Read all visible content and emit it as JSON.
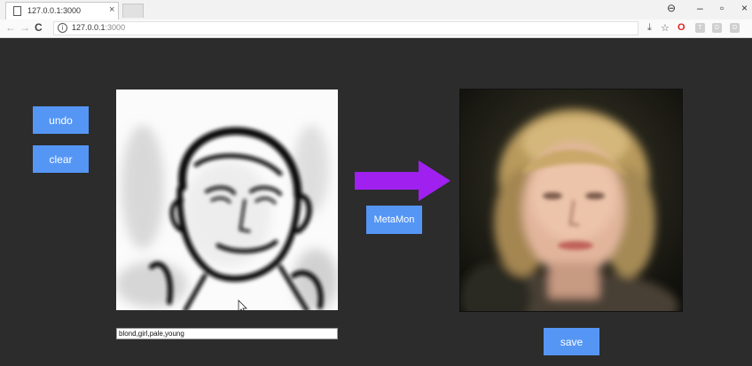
{
  "browser": {
    "tab_title": "127.0.0.1:3000",
    "tab_close": "×",
    "url_host": "127.0.0.1",
    "url_port": ":3000",
    "window_controls": [
      "–",
      "▫",
      "×"
    ]
  },
  "sidebar": {
    "undo_label": "undo",
    "clear_label": "clear"
  },
  "canvas": {
    "attributes_value": "blond,girl,pale,young"
  },
  "center": {
    "generate_label": "MetaMon",
    "arrow_color": "#a020f0"
  },
  "output": {
    "save_label": "save"
  },
  "colors": {
    "button": "#5596f5",
    "background": "#2c2c2c"
  }
}
